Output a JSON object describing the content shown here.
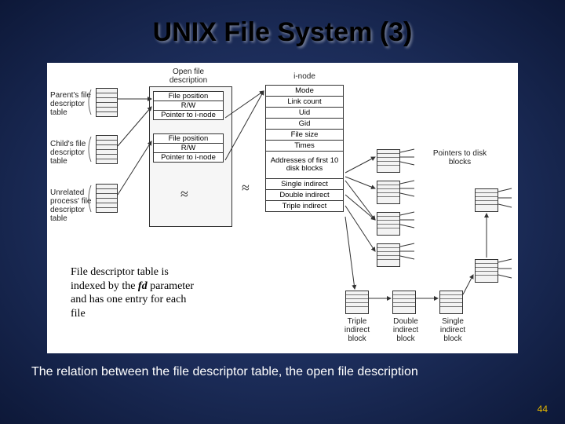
{
  "title": "UNIX File System (3)",
  "footer": "The relation between the file descriptor table, the open file description",
  "page_number": "44",
  "caption": {
    "pre": "File descriptor table is indexed by the ",
    "em": "fd",
    "post": " parameter and has one entry for each file"
  },
  "labels": {
    "ofd_header": "Open file\ndescription",
    "parent": "Parent's\nfile\ndescriptor\ntable",
    "child": "Child's\nfile\ndescriptor\ntable",
    "unrelated": "Unrelated\nprocess'\nfile\ndescriptor\ntable",
    "inode_header": "i-node",
    "pointers_to_disk": "Pointers to\ndisk blocks",
    "triple_lbl": "Triple\nindirect\nblock",
    "double_lbl": "Double\nindirect\nblock",
    "single_lbl": "Single\nindirect\nblock"
  },
  "ofd_box1": [
    "File position",
    "R/W",
    "Pointer to i-node"
  ],
  "ofd_box2": [
    "File position",
    "R/W",
    "Pointer to i-node"
  ],
  "inode_fields": [
    "Mode",
    "Link count",
    "Uid",
    "Gid",
    "File size",
    "Times",
    "Addresses of\nfirst 10\ndisk blocks",
    "Single indirect",
    "Double indirect",
    "Triple indirect"
  ]
}
